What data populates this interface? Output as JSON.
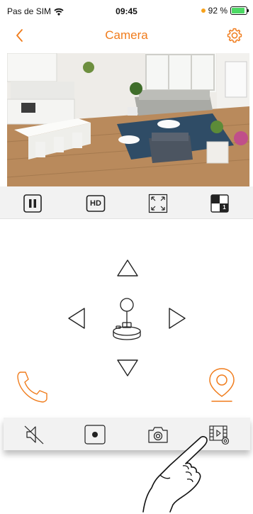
{
  "status_bar": {
    "carrier": "Pas de SIM",
    "time": "09:45",
    "battery_percent": "92 %",
    "battery_level": 0.92,
    "accent_dot_color": "#f7a21b",
    "battery_fill_color": "#4cd964"
  },
  "nav": {
    "title": "Camera",
    "accent_color": "#f07c1c",
    "back_icon": "chevron-left-icon",
    "settings_icon": "gear-icon"
  },
  "video_controls": {
    "pause_icon": "pause-icon",
    "quality_label": "HD",
    "fullscreen_icon": "fullscreen-icon",
    "layout_label": "1"
  },
  "ptz": {
    "up_icon": "triangle-up-icon",
    "down_icon": "triangle-down-icon",
    "left_icon": "triangle-left-icon",
    "right_icon": "triangle-right-icon",
    "center_icon": "joystick-icon",
    "call_icon": "phone-icon",
    "location_icon": "map-pin-icon"
  },
  "bottom_toolbar": {
    "mute_icon": "speaker-muted-icon",
    "record_icon": "record-icon",
    "snapshot_icon": "camera-icon",
    "gallery_icon": "video-gallery-icon"
  }
}
